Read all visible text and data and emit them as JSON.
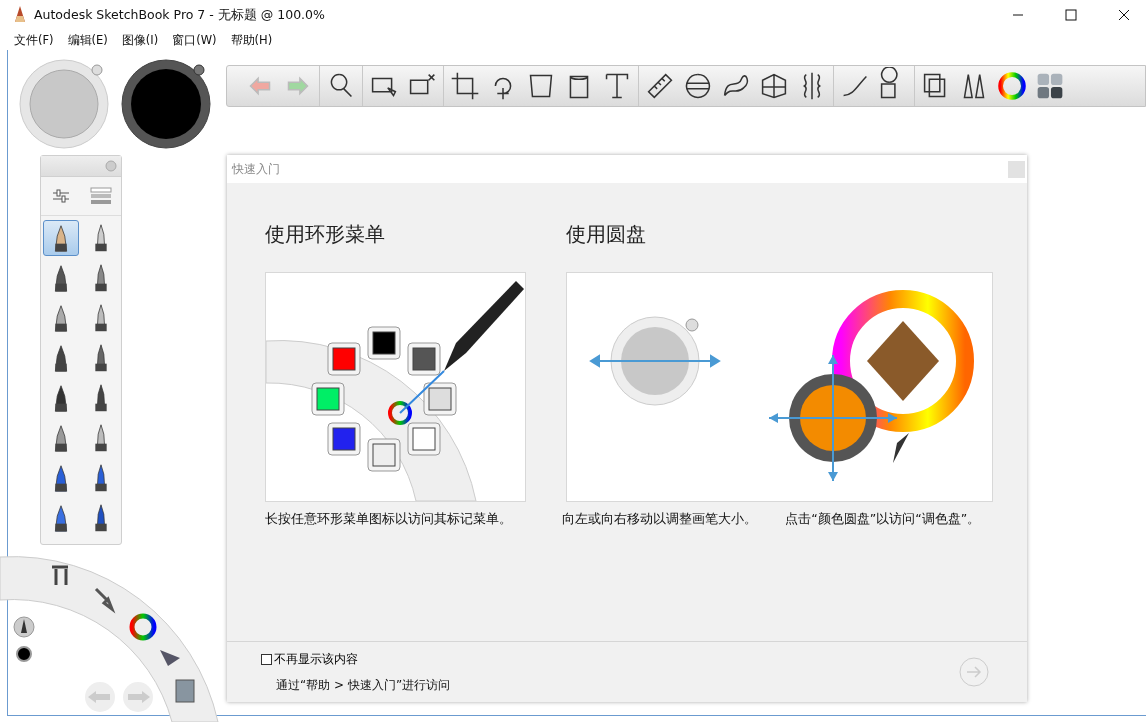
{
  "window": {
    "title": "Autodesk SketchBook Pro 7 - 无标题 @ 100.0%"
  },
  "menu": [
    {
      "label": "文件(F)"
    },
    {
      "label": "编辑(E)"
    },
    {
      "label": "图像(I)"
    },
    {
      "label": "窗口(W)"
    },
    {
      "label": "帮助(H)"
    }
  ],
  "brush_palette": {
    "brushes": [
      {
        "selected": true
      },
      {
        "selected": false
      },
      {
        "selected": false
      },
      {
        "selected": false
      },
      {
        "selected": false
      },
      {
        "selected": false
      },
      {
        "selected": false
      },
      {
        "selected": false
      },
      {
        "selected": false
      },
      {
        "selected": false
      },
      {
        "selected": false
      },
      {
        "selected": false
      },
      {
        "selected": false
      },
      {
        "selected": false
      },
      {
        "selected": false
      },
      {
        "selected": false
      }
    ]
  },
  "dialog": {
    "title": "快速入门",
    "sections": [
      {
        "heading": "使用环形菜单"
      },
      {
        "heading": "使用圆盘"
      }
    ],
    "captions": [
      "长按任意环形菜单图标以访问其标记菜单。",
      "向左或向右移动以调整画笔大小。",
      "点击“颜色圆盘”以访问“调色盘”。"
    ],
    "dont_show_again": {
      "label": "不再显示该内容",
      "checked": false
    },
    "footer_note": "通过“帮助 > 快速入门”进行访问"
  }
}
